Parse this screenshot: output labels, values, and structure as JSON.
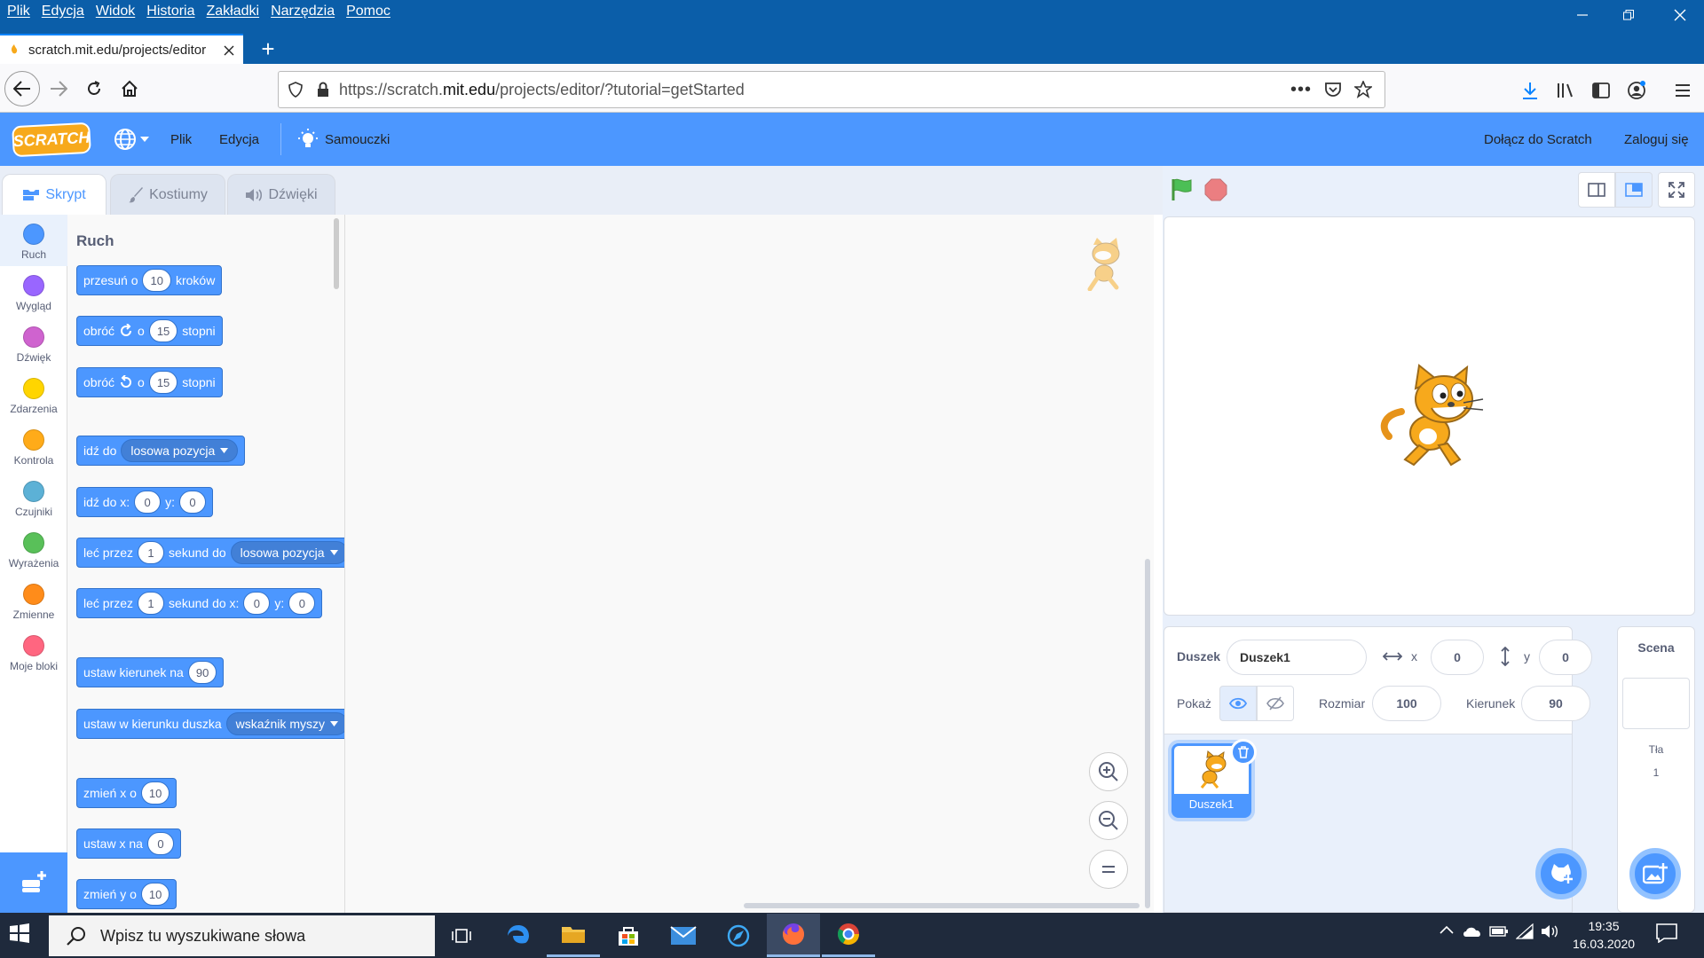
{
  "os_menu": [
    "Plik",
    "Edycja",
    "Widok",
    "Historia",
    "Zakładki",
    "Narzędzia",
    "Pomoc"
  ],
  "browser": {
    "tab_title": "scratch.mit.edu/projects/editor",
    "url_prefix": "https://scratch.",
    "url_domain": "mit.edu",
    "url_suffix": "/projects/editor/?tutorial=getStarted"
  },
  "scratch_menu": {
    "logo": "SCRATCH",
    "file": "Plik",
    "edit": "Edycja",
    "tutorials": "Samouczki",
    "join": "Dołącz do Scratch",
    "login": "Zaloguj się"
  },
  "editor_tabs": {
    "code": "Skrypt",
    "costumes": "Kostiumy",
    "sounds": "Dźwięki"
  },
  "categories": [
    {
      "label": "Ruch",
      "color": "#4c97ff"
    },
    {
      "label": "Wygląd",
      "color": "#9966ff"
    },
    {
      "label": "Dźwięk",
      "color": "#cf63cf"
    },
    {
      "label": "Zdarzenia",
      "color": "#ffd500"
    },
    {
      "label": "Kontrola",
      "color": "#ffab19"
    },
    {
      "label": "Czujniki",
      "color": "#5cb1d6"
    },
    {
      "label": "Wyrażenia",
      "color": "#59c059"
    },
    {
      "label": "Zmienne",
      "color": "#ff8c1a"
    },
    {
      "label": "Moje bloki",
      "color": "#ff6680"
    }
  ],
  "palette": {
    "heading": "Ruch",
    "b1": {
      "a": "przesuń o",
      "v": "10",
      "b": "kroków"
    },
    "b2": {
      "a": "obróć",
      "o": "o",
      "v": "15",
      "b": "stopni"
    },
    "b3": {
      "a": "obróć",
      "o": "o",
      "v": "15",
      "b": "stopni"
    },
    "b4": {
      "a": "idź do",
      "dd": "losowa pozycja"
    },
    "b5": {
      "a": "idź do x:",
      "x": "0",
      "y_label": "y:",
      "y": "0"
    },
    "b6": {
      "a": "leć przez",
      "v": "1",
      "b": "sekund do",
      "dd": "losowa pozycja"
    },
    "b7": {
      "a": "leć przez",
      "v": "1",
      "b": "sekund do x:",
      "x": "0",
      "y_label": "y:",
      "y": "0"
    },
    "b8": {
      "a": "ustaw kierunek na",
      "v": "90"
    },
    "b9": {
      "a": "ustaw w kierunku duszka",
      "dd": "wskaźnik myszy"
    },
    "b10": {
      "a": "zmień x o",
      "v": "10"
    },
    "b11": {
      "a": "ustaw x na",
      "v": "0"
    },
    "b12": {
      "a": "zmień y o",
      "v": "10"
    }
  },
  "sprite_info": {
    "sprite_label": "Duszek",
    "sprite_name": "Duszek1",
    "x_label": "x",
    "x": "0",
    "y_label": "y",
    "y": "0",
    "show_label": "Pokaż",
    "size_label": "Rozmiar",
    "size": "100",
    "direction_label": "Kierunek",
    "direction": "90"
  },
  "sprite_list": [
    {
      "name": "Duszek1"
    }
  ],
  "stage_panel": {
    "title": "Scena",
    "backdrops_label": "Tła",
    "backdrops_count": "1"
  },
  "taskbar": {
    "search_placeholder": "Wpisz tu wyszukiwane słowa",
    "time": "19:35",
    "date": "16.03.2020"
  }
}
